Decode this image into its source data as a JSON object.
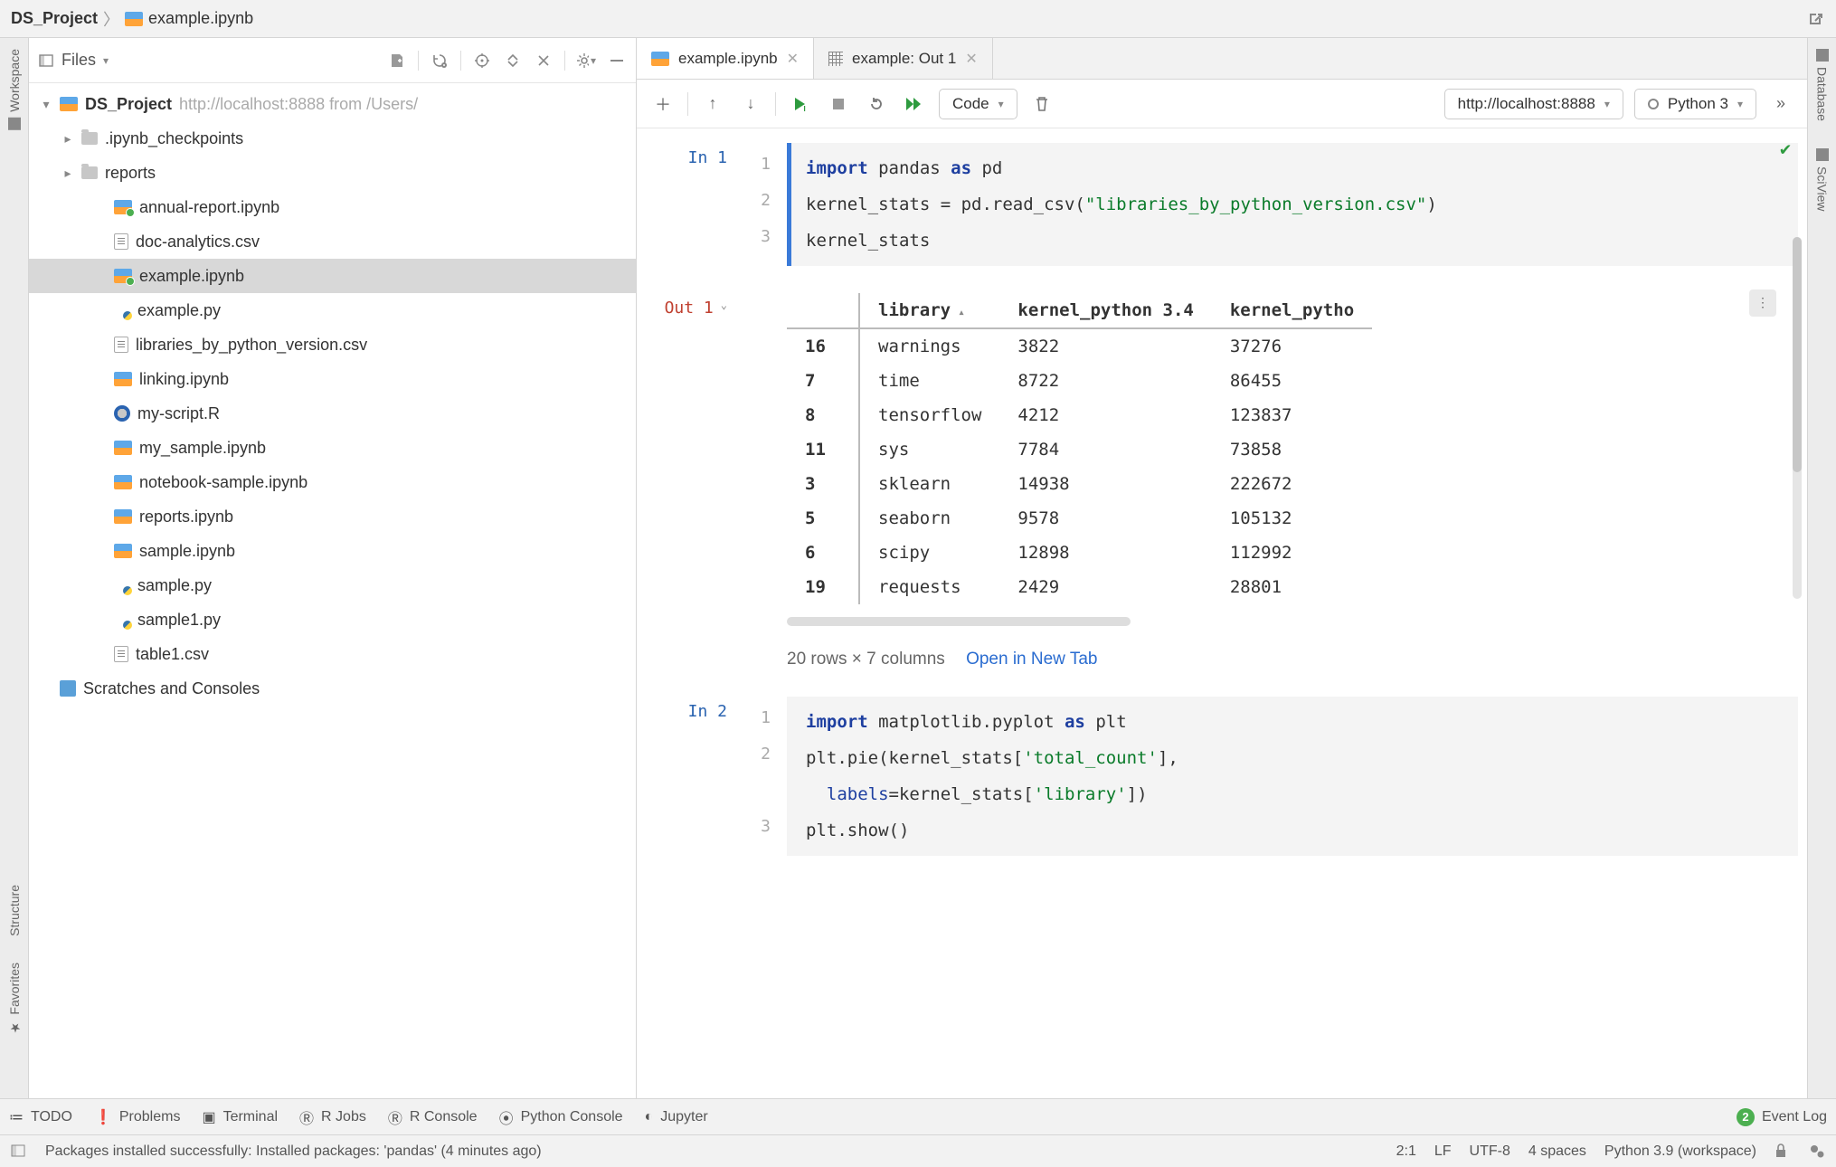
{
  "breadcrumb": {
    "project": "DS_Project",
    "file": "example.ipynb"
  },
  "sidebar": {
    "dropdown": "Files",
    "root": {
      "name": "DS_Project",
      "url": "http://localhost:8888 from /Users/"
    },
    "folders": [
      ".ipynb_checkpoints",
      "reports"
    ],
    "files": [
      {
        "name": "annual-report.ipynb",
        "type": "ipynb",
        "dot": true
      },
      {
        "name": "doc-analytics.csv",
        "type": "csv"
      },
      {
        "name": "example.ipynb",
        "type": "ipynb",
        "dot": true,
        "selected": true
      },
      {
        "name": "example.py",
        "type": "py"
      },
      {
        "name": "libraries_by_python_version.csv",
        "type": "csv"
      },
      {
        "name": "linking.ipynb",
        "type": "ipynb"
      },
      {
        "name": "my-script.R",
        "type": "r"
      },
      {
        "name": "my_sample.ipynb",
        "type": "ipynb"
      },
      {
        "name": "notebook-sample.ipynb",
        "type": "ipynb"
      },
      {
        "name": "reports.ipynb",
        "type": "ipynb"
      },
      {
        "name": "sample.ipynb",
        "type": "ipynb"
      },
      {
        "name": "sample.py",
        "type": "py"
      },
      {
        "name": "sample1.py",
        "type": "py"
      },
      {
        "name": "table1.csv",
        "type": "csv"
      }
    ],
    "scratches": "Scratches and Consoles"
  },
  "left_tools": [
    {
      "label": "Workspace"
    },
    {
      "label": "Structure"
    },
    {
      "label": "Favorites"
    }
  ],
  "right_tools": [
    {
      "label": "Database"
    },
    {
      "label": "SciView"
    }
  ],
  "tabs": [
    {
      "label": "example.ipynb",
      "type": "ipynb",
      "active": true
    },
    {
      "label": "example: Out 1",
      "type": "grid",
      "active": false
    }
  ],
  "nb_toolbar": {
    "cell_type": "Code",
    "server": "http://localhost:8888",
    "kernel": "Python 3"
  },
  "cells": [
    {
      "prompt": "In 1",
      "lines": [
        {
          "n": "1",
          "html": "<span class='kw'>import</span> pandas <span class='kw'>as</span> pd"
        },
        {
          "n": "2",
          "html": "kernel_stats = pd.read_csv(<span class='str'>\"libraries_by_python_version.csv\"</span>)"
        },
        {
          "n": "3",
          "html": "kernel_stats"
        }
      ]
    },
    {
      "prompt": "Out 1",
      "type": "output"
    },
    {
      "prompt": "In 2",
      "lines": [
        {
          "n": "1",
          "html": "<span class='kw'>import</span> matplotlib.pyplot <span class='kw'>as</span> plt"
        },
        {
          "n": "2",
          "html": "plt.pie(kernel_stats[<span class='str'>'total_count'</span>],\n  <span class='kw2'>labels</span>=kernel_stats[<span class='str'>'library'</span>])"
        },
        {
          "n": "3",
          "html": "plt.show()"
        }
      ]
    }
  ],
  "output_table": {
    "columns": [
      "library",
      "kernel_python 3.4",
      "kernel_pytho"
    ],
    "rows": [
      {
        "idx": "16",
        "cells": [
          "warnings",
          "3822",
          "37276"
        ]
      },
      {
        "idx": "7",
        "cells": [
          "time",
          "8722",
          "86455"
        ]
      },
      {
        "idx": "8",
        "cells": [
          "tensorflow",
          "4212",
          "123837"
        ]
      },
      {
        "idx": "11",
        "cells": [
          "sys",
          "7784",
          "73858"
        ]
      },
      {
        "idx": "3",
        "cells": [
          "sklearn",
          "14938",
          "222672"
        ]
      },
      {
        "idx": "5",
        "cells": [
          "seaborn",
          "9578",
          "105132"
        ]
      },
      {
        "idx": "6",
        "cells": [
          "scipy",
          "12898",
          "112992"
        ]
      },
      {
        "idx": "19",
        "cells": [
          "requests",
          "2429",
          "28801"
        ]
      }
    ],
    "footer": "20 rows × 7 columns",
    "open_link": "Open in New Tab"
  },
  "bottom_tools": [
    "TODO",
    "Problems",
    "Terminal",
    "R Jobs",
    "R Console",
    "Python Console",
    "Jupyter"
  ],
  "event_log": {
    "badge": "2",
    "label": "Event Log"
  },
  "status": {
    "msg": "Packages installed successfully: Installed packages: 'pandas' (4 minutes ago)",
    "pos": "2:1",
    "eol": "LF",
    "enc": "UTF-8",
    "indent": "4 spaces",
    "interpreter": "Python 3.9 (workspace)"
  }
}
